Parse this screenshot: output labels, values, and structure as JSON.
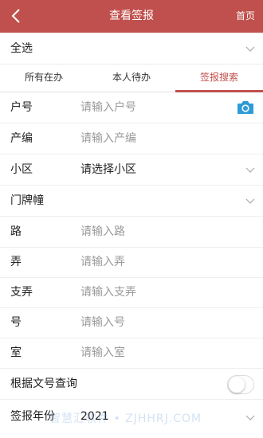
{
  "header": {
    "title": "查看签报",
    "home_label": "首页"
  },
  "select_all": {
    "label": "全选"
  },
  "tabs": [
    {
      "label": "所有在办"
    },
    {
      "label": "本人待办"
    },
    {
      "label": "签报搜索"
    }
  ],
  "fields": {
    "household": {
      "label": "户号",
      "placeholder": "请输入户号"
    },
    "property": {
      "label": "产编",
      "placeholder": "请输入产编"
    },
    "community": {
      "label": "小区",
      "value": "请选择小区"
    },
    "door_plate": {
      "label": "门牌幢"
    },
    "road": {
      "label": "路",
      "placeholder": "请输入路"
    },
    "lane": {
      "label": "弄",
      "placeholder": "请输入弄"
    },
    "branch_lane": {
      "label": "支弄",
      "placeholder": "请输入支弄"
    },
    "number": {
      "label": "号",
      "placeholder": "请输入号"
    },
    "room": {
      "label": "室",
      "placeholder": "请输入室"
    },
    "doc_query": {
      "label": "根据文号查询",
      "enabled": false
    },
    "year": {
      "label": "签报年份",
      "value": "2021"
    }
  },
  "watermark": {
    "text": "智慧汇软件 • ZJHHRJ.COM"
  },
  "colors": {
    "brand": "#c0504d",
    "camera": "#2e9bd6"
  }
}
